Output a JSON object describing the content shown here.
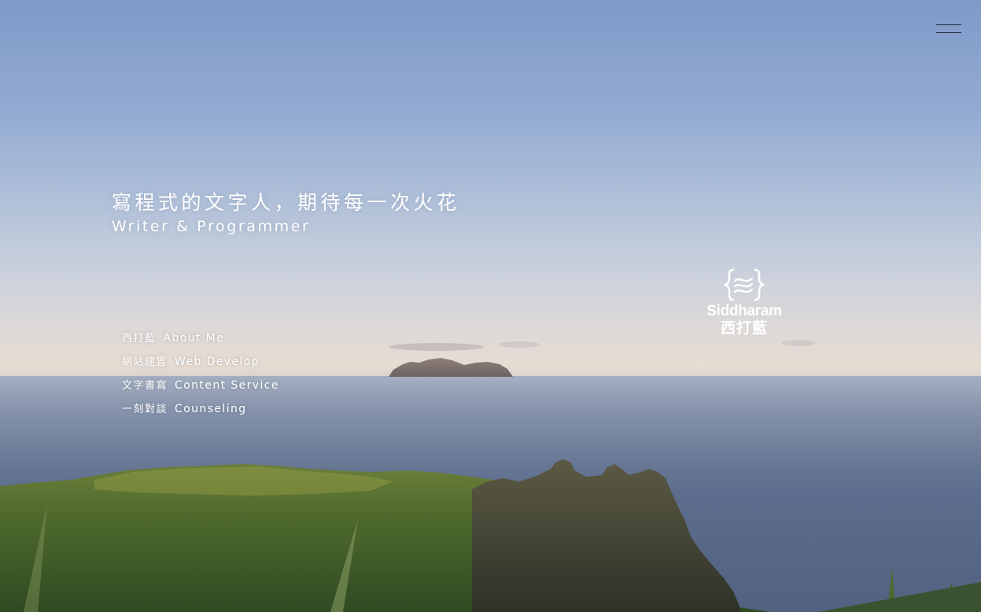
{
  "hero": {
    "tagline_zh": "寫程式的文字人，期待每一次火花",
    "tagline_en": "Writer & Programmer"
  },
  "nav": {
    "items": [
      {
        "zh": "西打藍",
        "en": "About Me"
      },
      {
        "zh": "網站建置",
        "en": "Web Develop"
      },
      {
        "zh": "文字書寫",
        "en": "Content Service"
      },
      {
        "zh": "一刻對談",
        "en": "Counseling"
      }
    ]
  },
  "logo": {
    "name_en": "Siddharam",
    "name_zh": "西打藍",
    "icon": "curly-braces-wave-icon"
  },
  "menu_toggle": {
    "icon": "hamburger-menu-icon"
  },
  "colors": {
    "text": "#ffffff",
    "menu_icon": "#1f2a44",
    "sky_top": "#7e9ac9",
    "horizon": "#e4dbd3",
    "sea": "#5d6d8d",
    "grass": "#4c6a2a"
  }
}
